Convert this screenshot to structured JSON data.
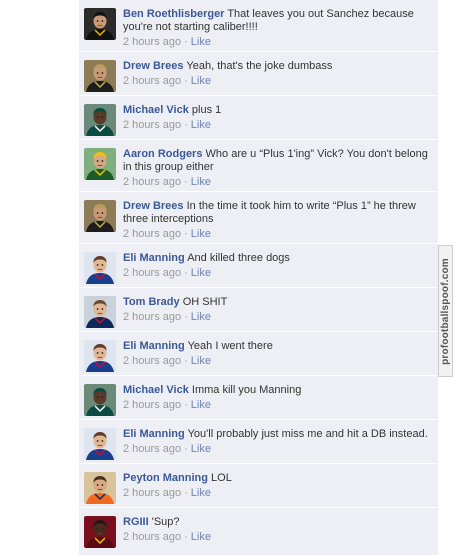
{
  "comments": [
    {
      "author": "Ben Roethlisberger",
      "text": "That leaves you out Sanchez because you're not starting caliber!!!!",
      "time": "2 hours ago",
      "like": "Like",
      "avatar": "steelers-qb-icon"
    },
    {
      "author": "Drew Brees",
      "text": "Yeah, that's the joke dumbass",
      "time": "2 hours ago",
      "like": "Like",
      "avatar": "saints-qb-icon"
    },
    {
      "author": "Michael Vick",
      "text": "plus 1",
      "time": "2 hours ago",
      "like": "Like",
      "avatar": "eagles-qb-icon"
    },
    {
      "author": "Aaron Rodgers",
      "text": "Who are u “Plus 1'ing” Vick? You don't belong in this group either",
      "time": "2 hours ago",
      "like": "Like",
      "avatar": "packers-qb-icon"
    },
    {
      "author": "Drew Brees",
      "text": "In the time it took him to write “Plus 1” he threw three interceptions",
      "time": "2 hours ago",
      "like": "Like",
      "avatar": "saints-qb-icon"
    },
    {
      "author": "Eli Manning",
      "text": "And killed three dogs",
      "time": "2 hours ago",
      "like": "Like",
      "avatar": "giants-qb-icon"
    },
    {
      "author": "Tom Brady",
      "text": "OH SHIT",
      "time": "2 hours ago",
      "like": "Like",
      "avatar": "patriots-qb-icon"
    },
    {
      "author": "Eli Manning",
      "text": "Yeah I went there",
      "time": "2 hours ago",
      "like": "Like",
      "avatar": "giants-qb-icon"
    },
    {
      "author": "Michael Vick",
      "text": "Imma kill you Manning",
      "time": "2 hours ago",
      "like": "Like",
      "avatar": "eagles-qb-icon"
    },
    {
      "author": "Eli Manning",
      "text": "You'll probably just miss me and hit a DB instead.",
      "time": "2 hours ago",
      "like": "Like",
      "avatar": "giants-qb-icon"
    },
    {
      "author": "Peyton Manning",
      "text": "LOL",
      "time": "2 hours ago",
      "like": "Like",
      "avatar": "broncos-qb-icon"
    },
    {
      "author": "RGIII",
      "text": "'Sup?",
      "time": "2 hours ago",
      "like": "Like",
      "avatar": "redskins-qb-icon"
    }
  ],
  "separator": "·",
  "watermark": "profootballspoof.com",
  "colors": {
    "author": "#3b5998",
    "meta": "#999999",
    "like": "#6d84b4",
    "background": "#edeff4"
  }
}
